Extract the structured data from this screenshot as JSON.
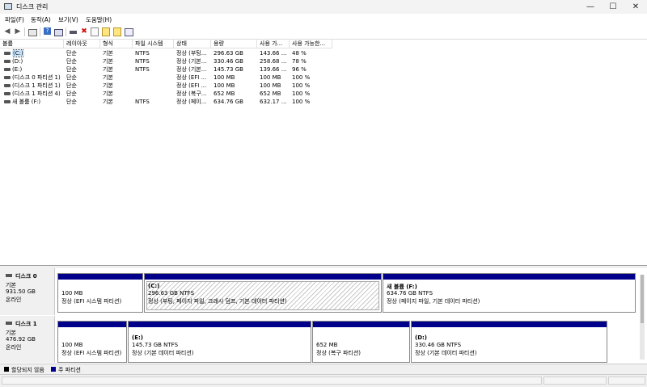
{
  "window": {
    "title": "디스크 관리",
    "controls": {
      "minimize": "—",
      "maximize": "☐",
      "close": "✕"
    }
  },
  "menu": [
    "파일(F)",
    "동작(A)",
    "보기(V)",
    "도움말(H)"
  ],
  "toolbar": {
    "icons": [
      "back-icon",
      "forward-icon",
      "up-icon",
      "properties-icon",
      "help-icon",
      "console-icon",
      "connect-icon",
      "delete-icon",
      "checklist-icon",
      "new-volume-icon",
      "search-icon",
      "settings-icon"
    ],
    "glyphs": {
      "back": "◀",
      "forward": "▶",
      "delete": "✖"
    }
  },
  "volume_list": {
    "columns": [
      "볼륨",
      "레이아웃",
      "형식",
      "파일 시스템",
      "상태",
      "용량",
      "사용 가...",
      "사용 가능한..."
    ],
    "rows": [
      {
        "volume": "(C:)",
        "layout": "단순",
        "type": "기본",
        "fs": "NTFS",
        "status": "정상 (부팅...",
        "capacity": "296.63 GB",
        "free": "143.66 ...",
        "pct": "48 %"
      },
      {
        "volume": "(D:)",
        "layout": "단순",
        "type": "기본",
        "fs": "NTFS",
        "status": "정상 (기본...",
        "capacity": "330.46 GB",
        "free": "258.68 ...",
        "pct": "78 %"
      },
      {
        "volume": "(E:)",
        "layout": "단순",
        "type": "기본",
        "fs": "NTFS",
        "status": "정상 (기본...",
        "capacity": "145.73 GB",
        "free": "139.66 ...",
        "pct": "96 %"
      },
      {
        "volume": "(디스크 0 파티션 1)",
        "layout": "단순",
        "type": "기본",
        "fs": "",
        "status": "정상 (EFI ...",
        "capacity": "100 MB",
        "free": "100 MB",
        "pct": "100 %"
      },
      {
        "volume": "(디스크 1 파티션 1)",
        "layout": "단순",
        "type": "기본",
        "fs": "",
        "status": "정상 (EFI ...",
        "capacity": "100 MB",
        "free": "100 MB",
        "pct": "100 %"
      },
      {
        "volume": "(디스크 1 파티션 4)",
        "layout": "단순",
        "type": "기본",
        "fs": "",
        "status": "정상 (복구...",
        "capacity": "652 MB",
        "free": "652 MB",
        "pct": "100 %"
      },
      {
        "volume": "새 볼륨 (F:)",
        "layout": "단순",
        "type": "기본",
        "fs": "NTFS",
        "status": "정상 (페이...",
        "capacity": "634.76 GB",
        "free": "632.17 ...",
        "pct": "100 %"
      }
    ]
  },
  "disks": [
    {
      "name": "디스크 0",
      "kind": "기본",
      "size": "931.50 GB",
      "state": "온라인",
      "partitions": [
        {
          "title": "",
          "size": "100 MB",
          "status": "정상 (EFI 시스템 파티션)"
        },
        {
          "title": "(C:)",
          "size": "296.63 GB NTFS",
          "status": "정상 (부팅, 페이지 파일, 크래시 덤프, 기본 데이터 파티션)"
        },
        {
          "title": "새 볼륨  (F:)",
          "size": "634.76 GB NTFS",
          "status": "정상 (페이지 파일, 기본 데이터 파티션)"
        }
      ]
    },
    {
      "name": "디스크 1",
      "kind": "기본",
      "size": "476.92 GB",
      "state": "온라인",
      "partitions": [
        {
          "title": "",
          "size": "100 MB",
          "status": "정상 (EFI 시스템 파티션)"
        },
        {
          "title": "(E:)",
          "size": "145.73 GB NTFS",
          "status": "정상 (기본 데이터 파티션)"
        },
        {
          "title": "",
          "size": "652 MB",
          "status": "정상 (복구 파티션)"
        },
        {
          "title": "(D:)",
          "size": "330.46 GB NTFS",
          "status": "정상 (기본 데이터 파티션)"
        }
      ]
    }
  ],
  "legend": [
    {
      "label": "할당되지 않음",
      "color": "#000000"
    },
    {
      "label": "주 파티션",
      "color": "#00008b"
    }
  ]
}
